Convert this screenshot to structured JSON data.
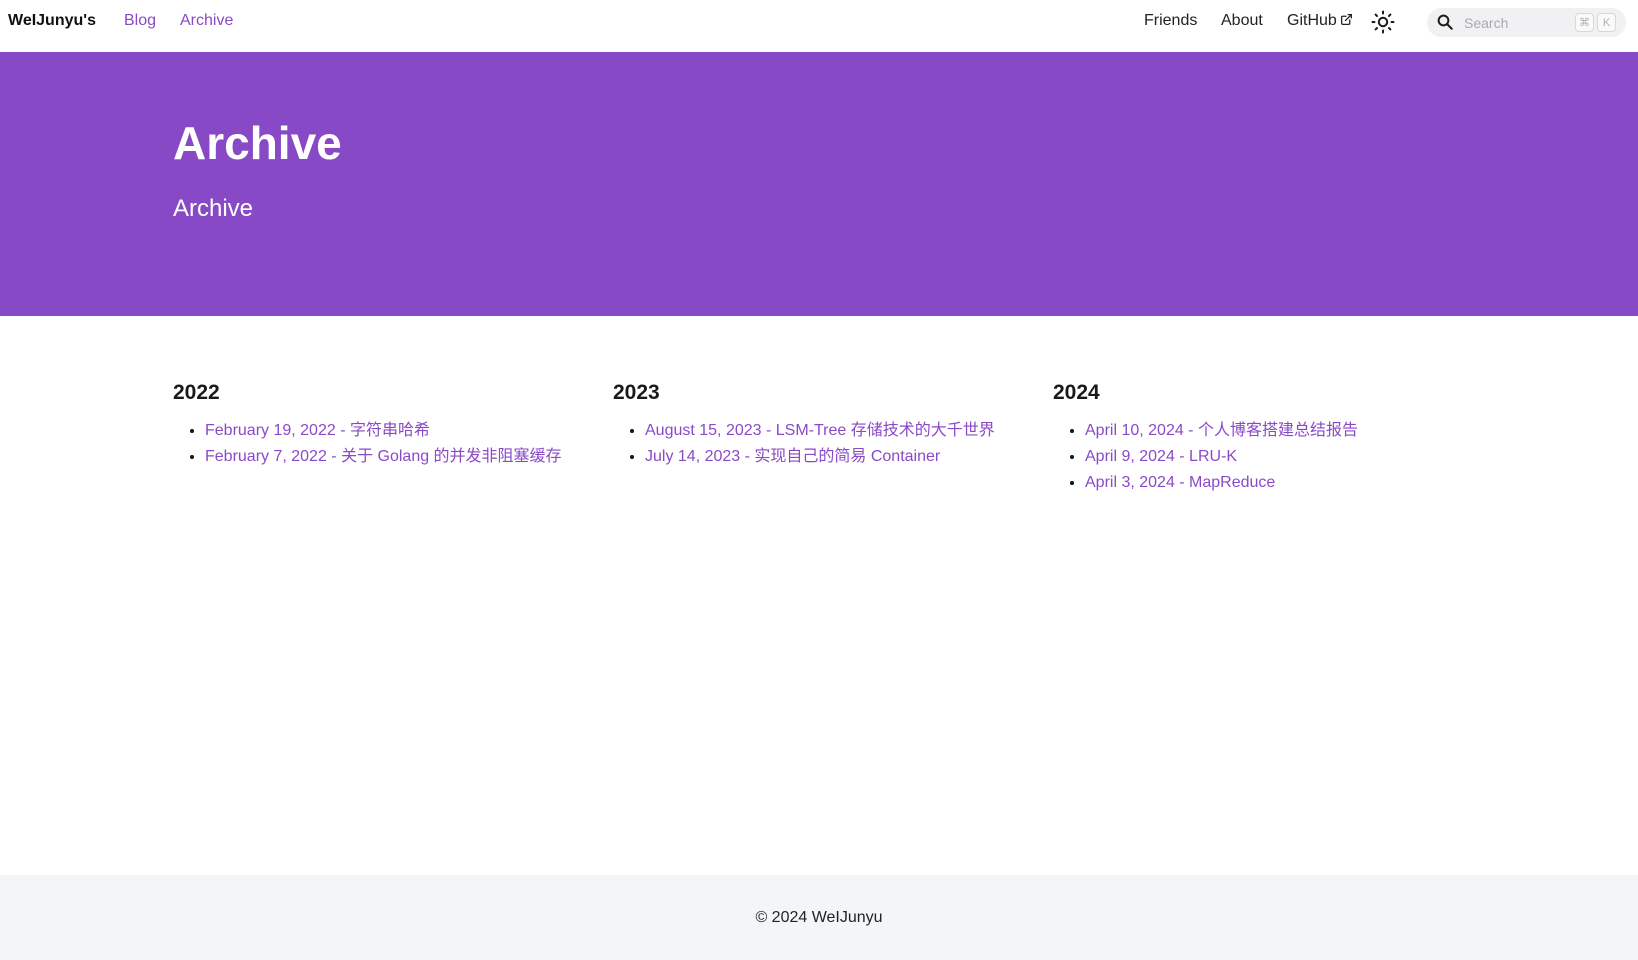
{
  "navbar": {
    "brand": "WeIJunyu's",
    "left_links": [
      "Blog",
      "Archive"
    ],
    "right_links": {
      "friends": "Friends",
      "about": "About",
      "github": "GitHub"
    },
    "search": {
      "placeholder": "Search",
      "shortcut_keys": [
        "⌘",
        "K"
      ]
    },
    "accent_color": "#8a4ac7"
  },
  "hero": {
    "title": "Archive",
    "subtitle": "Archive",
    "background": "#8749c6"
  },
  "archive": {
    "years": [
      {
        "year": "2022",
        "posts": [
          "February 19, 2022 - 字符串哈希",
          "February 7, 2022 - 关于 Golang 的并发非阻塞缓存"
        ]
      },
      {
        "year": "2023",
        "posts": [
          "August 15, 2023 - LSM-Tree 存储技术的大千世界",
          "July 14, 2023 - 实现自己的简易 Container"
        ]
      },
      {
        "year": "2024",
        "posts": [
          "April 10, 2024 - 个人博客搭建总结报告",
          "April 9, 2024 - LRU-K",
          "April 3, 2024 - MapReduce"
        ]
      }
    ]
  },
  "footer": {
    "copyright": "© 2024 WeIJunyu"
  }
}
